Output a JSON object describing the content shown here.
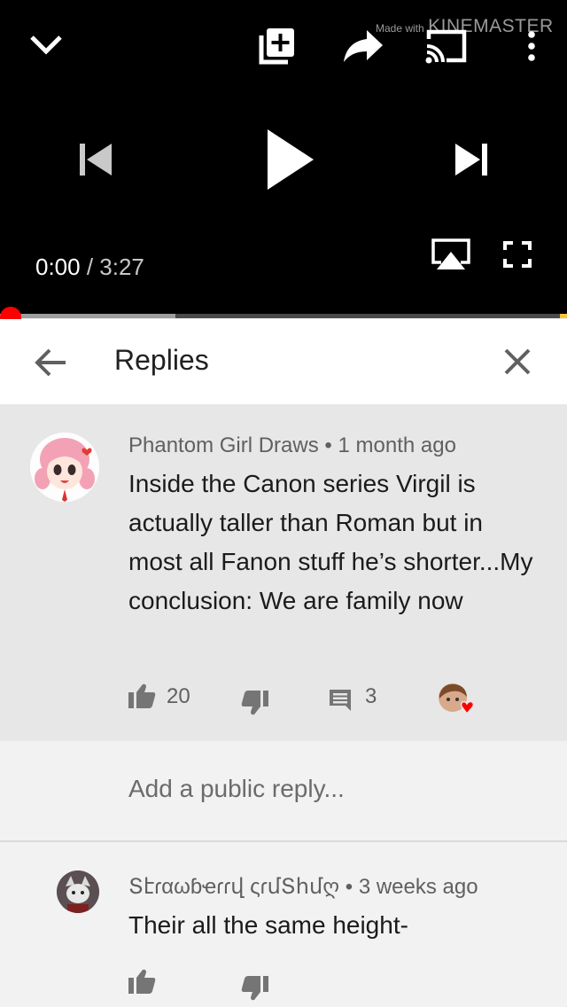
{
  "player": {
    "watermark_made": "Made with",
    "watermark_brand": "KINEMASTER",
    "current_time": "0:00",
    "separator": " / ",
    "duration": "3:27",
    "progress": 0,
    "buffered": 0.31,
    "colors": {
      "scrubber": "#ff0000",
      "buffer": "#9e9e9e",
      "track": "#4a4a4a"
    },
    "icons": [
      "chevron-down-icon",
      "add-to-playlist-icon",
      "share-icon",
      "cast-icon",
      "more-vert-icon",
      "previous-icon",
      "play-icon",
      "next-icon",
      "airplay-icon",
      "fullscreen-icon"
    ]
  },
  "header": {
    "title": "Replies",
    "icons": [
      "back-arrow-icon",
      "close-icon"
    ]
  },
  "parent_comment": {
    "author": "Phantom Girl Draws",
    "dot": "•",
    "age": "1 month ago",
    "text": "Inside the Canon series Virgil is actually taller than Roman but in most all Fanon stuff he’s shorter...My conclusion: We are family now",
    "likes": "20",
    "replies": "3",
    "icons": [
      "thumbs-up-icon",
      "thumbs-down-icon",
      "reply-icon",
      "creator-heart-icon"
    ]
  },
  "reply_input": {
    "placeholder": "Add a public reply..."
  },
  "child_comment": {
    "author": "Տէɾαωɓҽɾɾվ ςɾմՏհմღ",
    "dot": "•",
    "age": "3 weeks ago",
    "text": "Their all the same height-",
    "icons": [
      "thumbs-up-icon",
      "thumbs-down-icon"
    ]
  }
}
